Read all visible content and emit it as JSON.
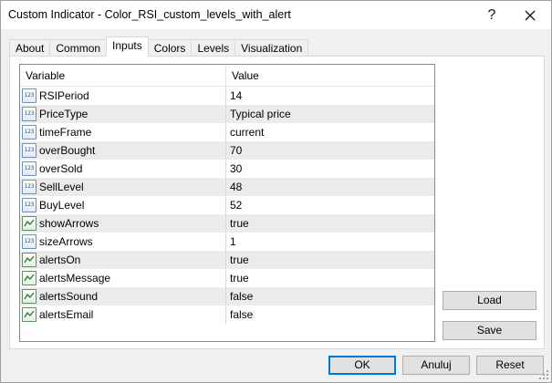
{
  "window": {
    "title": "Custom Indicator - Color_RSI_custom_levels_with_alert",
    "help_glyph": "?",
    "close_icon": "close-icon"
  },
  "tabs": [
    {
      "label": "About",
      "active": false
    },
    {
      "label": "Common",
      "active": false
    },
    {
      "label": "Inputs",
      "active": true
    },
    {
      "label": "Colors",
      "active": false
    },
    {
      "label": "Levels",
      "active": false
    },
    {
      "label": "Visualization",
      "active": false
    }
  ],
  "inputs": {
    "columns": {
      "variable": "Variable",
      "value": "Value"
    },
    "icon_number_text": "123",
    "rows": [
      {
        "name": "RSIPeriod",
        "value": "14",
        "type": "number"
      },
      {
        "name": "PriceType",
        "value": "Typical price",
        "type": "number"
      },
      {
        "name": "timeFrame",
        "value": "current",
        "type": "number"
      },
      {
        "name": "overBought",
        "value": "70",
        "type": "number"
      },
      {
        "name": "overSold",
        "value": "30",
        "type": "number"
      },
      {
        "name": "SellLevel",
        "value": "48",
        "type": "number"
      },
      {
        "name": "BuyLevel",
        "value": "52",
        "type": "number"
      },
      {
        "name": "showArrows",
        "value": "true",
        "type": "bool"
      },
      {
        "name": "sizeArrows",
        "value": "1",
        "type": "number"
      },
      {
        "name": "alertsOn",
        "value": "true",
        "type": "bool"
      },
      {
        "name": "alertsMessage",
        "value": "true",
        "type": "bool"
      },
      {
        "name": "alertsSound",
        "value": "false",
        "type": "bool"
      },
      {
        "name": "alertsEmail",
        "value": "false",
        "type": "bool"
      }
    ]
  },
  "buttons": {
    "load": "Load",
    "save": "Save",
    "ok": "OK",
    "cancel": "Anuluj",
    "reset": "Reset"
  }
}
